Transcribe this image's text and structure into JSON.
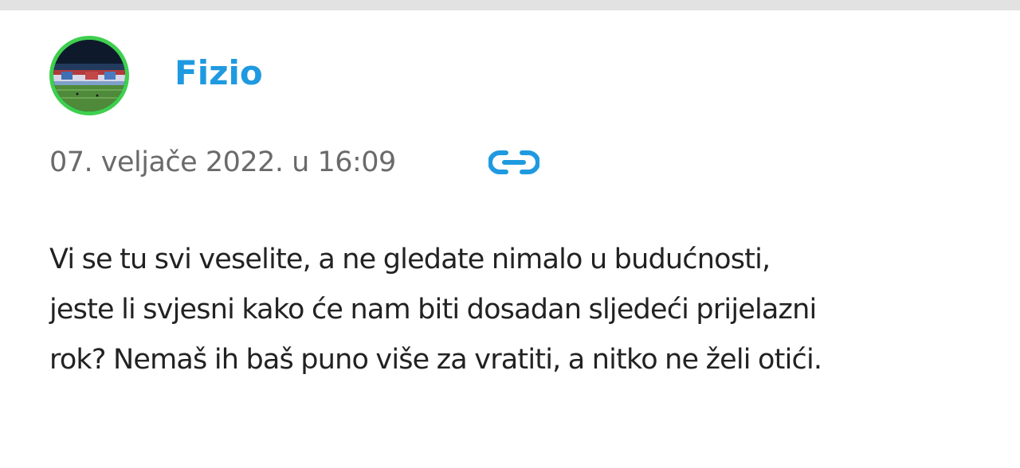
{
  "comment": {
    "author": {
      "name": "Fizio",
      "avatar_icon": "stadium-photo-avatar",
      "avatar_ring_color": "#3ecf4e",
      "name_color": "#1f9ae0"
    },
    "timestamp": "07. veljače 2022. u 16:09",
    "permalink_icon": "link-icon",
    "body_lines": [
      "Vi se tu svi veselite, a ne gledate nimalo u budućnosti,",
      "jeste li svjesni kako će nam biti dosadan sljedeći prijelazni",
      "rok? Nemaš ih baš puno više za vratiti, a nitko ne želi otići."
    ]
  }
}
